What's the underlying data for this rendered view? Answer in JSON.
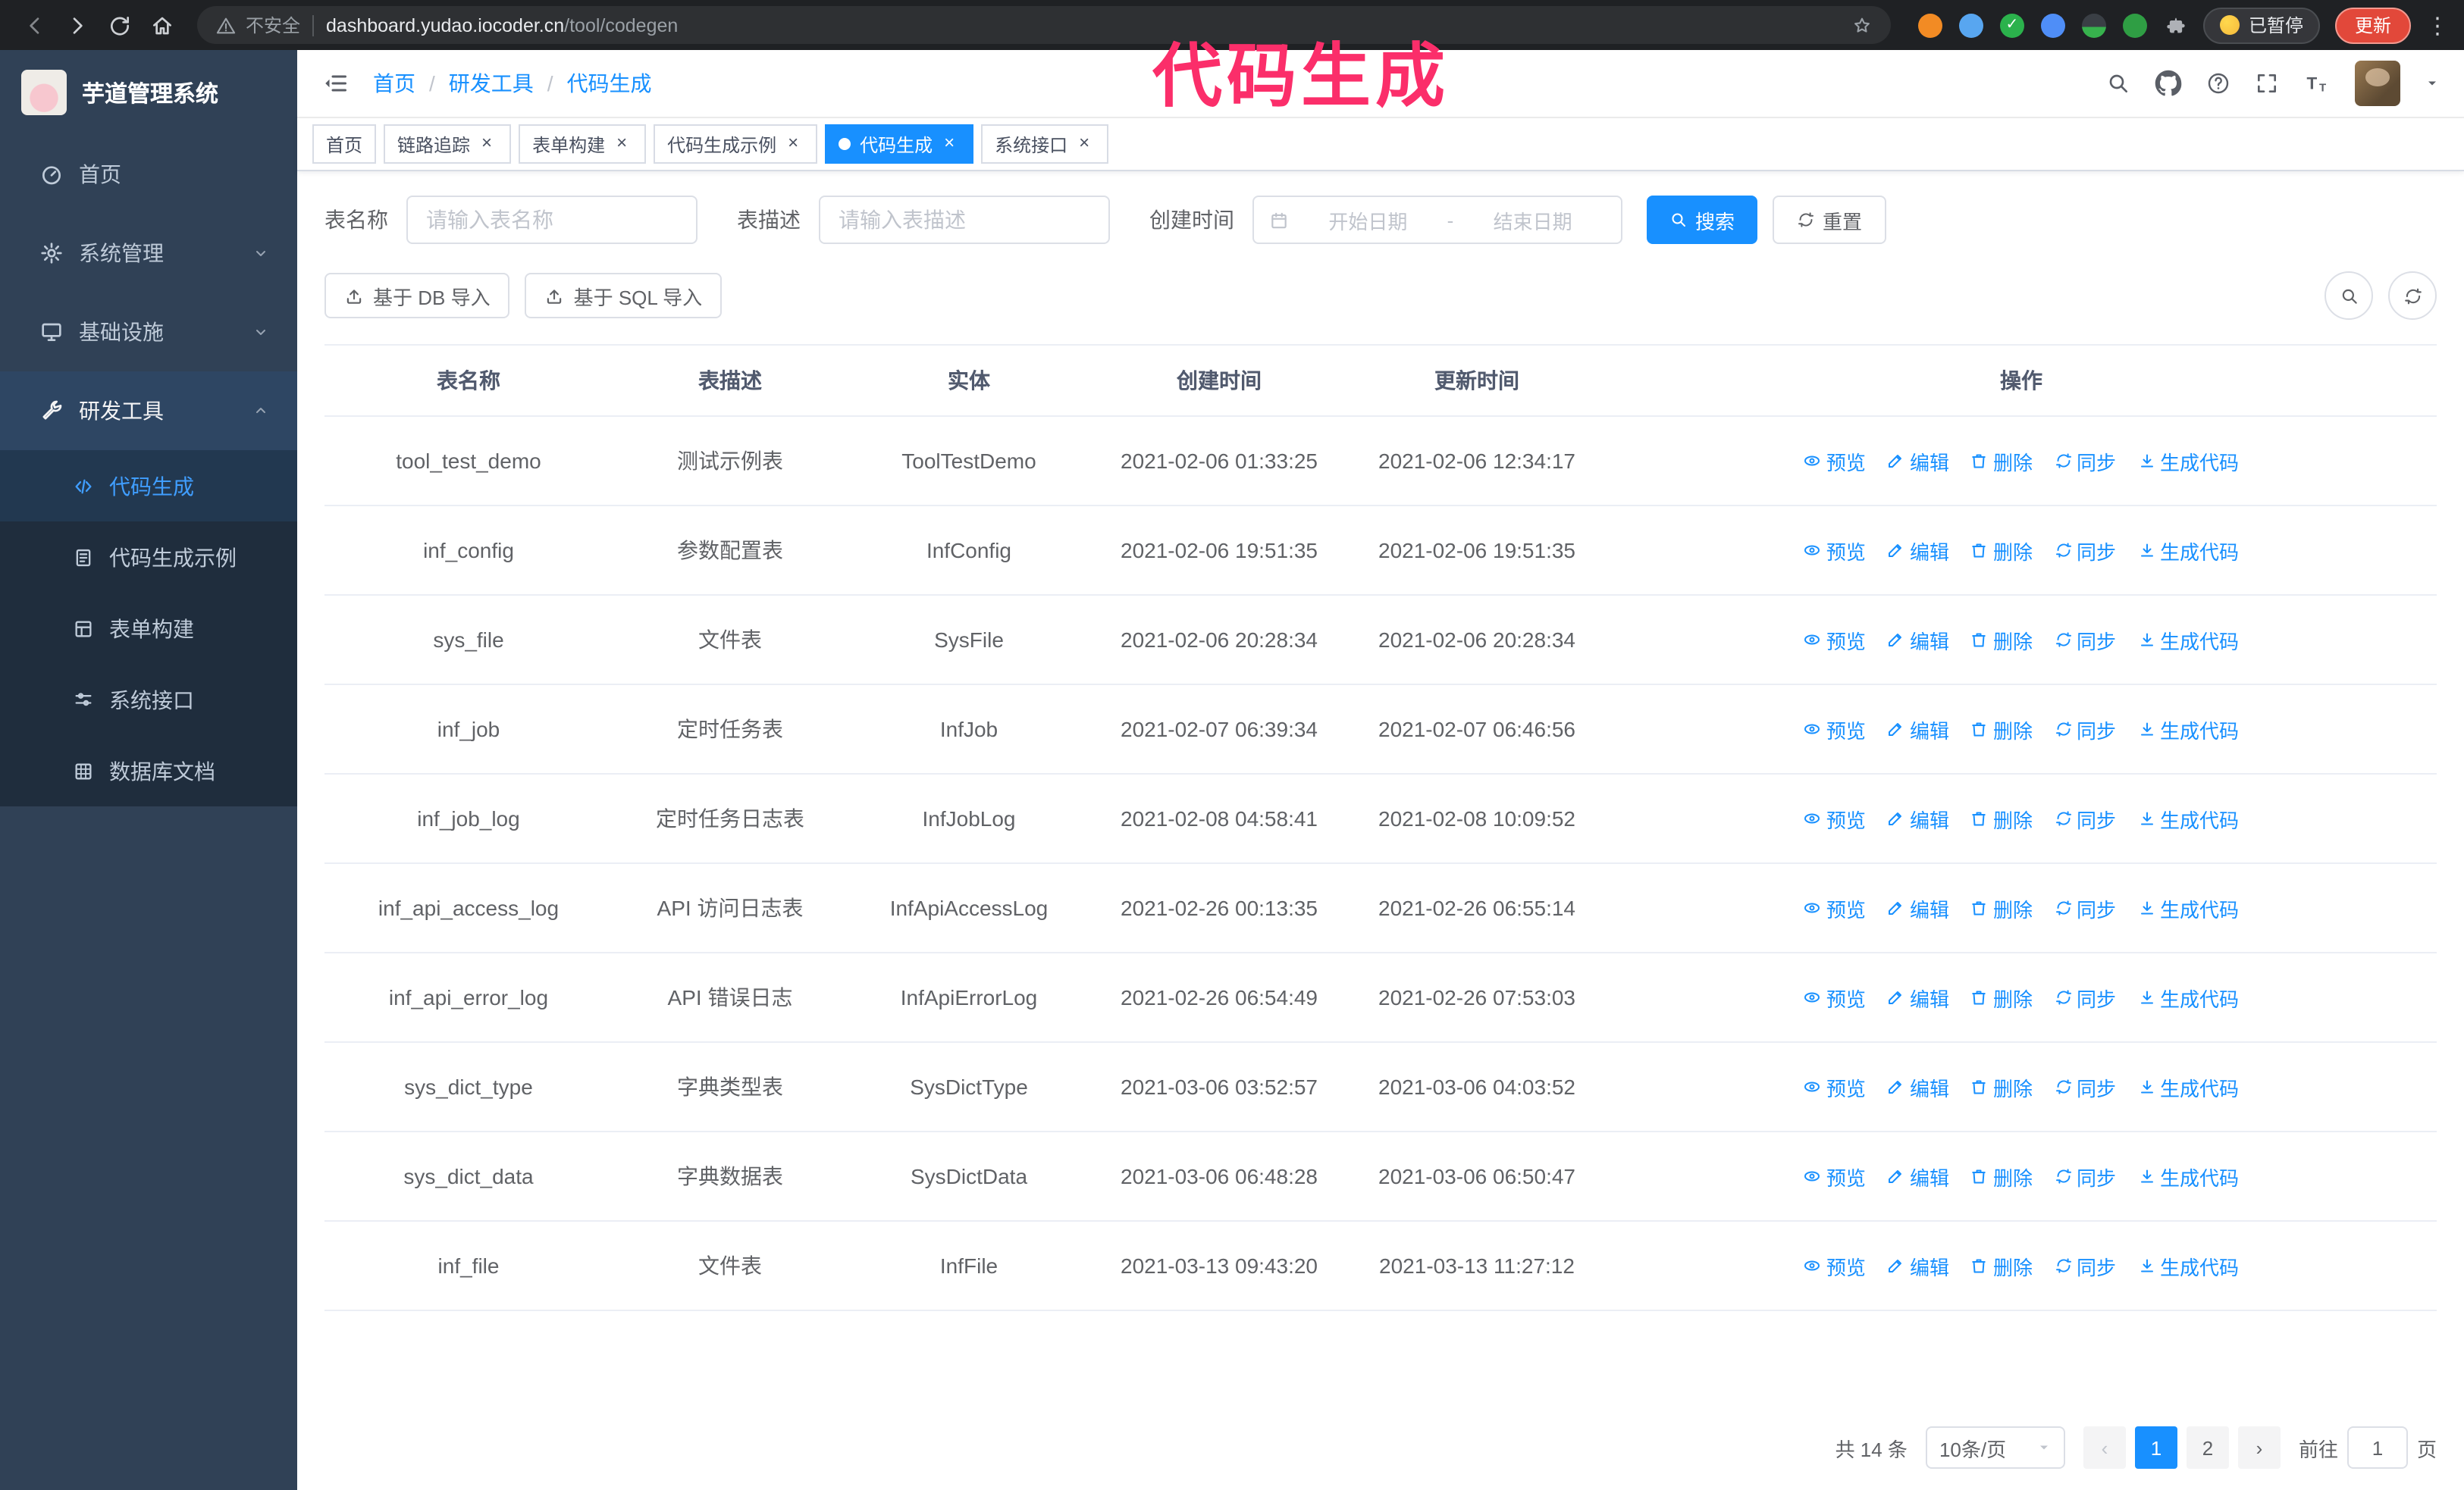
{
  "browser": {
    "security_label": "不安全",
    "url_domain": "dashboard.yudao.iocoder.cn",
    "url_path": "/tool/codegen",
    "paused_badge": "已暂停",
    "update_button": "更新"
  },
  "annotation": "代码生成",
  "glyphs": {
    "close": "×",
    "breadcrumb_separator": "/",
    "date_separator": "-",
    "pager_prev": "‹",
    "pager_next": "›",
    "more_dots": "⋮"
  },
  "sidebar": {
    "logo_title": "芋道管理系统",
    "items": [
      {
        "label": "首页"
      },
      {
        "label": "系统管理"
      },
      {
        "label": "基础设施"
      },
      {
        "label": "研发工具"
      }
    ],
    "subitems": [
      {
        "label": "代码生成"
      },
      {
        "label": "代码生成示例"
      },
      {
        "label": "表单构建"
      },
      {
        "label": "系统接口"
      },
      {
        "label": "数据库文档"
      }
    ]
  },
  "breadcrumb": {
    "items": [
      "首页",
      "研发工具",
      "代码生成"
    ]
  },
  "tabs": [
    {
      "label": "首页"
    },
    {
      "label": "链路追踪"
    },
    {
      "label": "表单构建"
    },
    {
      "label": "代码生成示例"
    },
    {
      "label": "代码生成"
    },
    {
      "label": "系统接口"
    }
  ],
  "filters": {
    "table_name_label": "表名称",
    "table_name_placeholder": "请输入表名称",
    "table_desc_label": "表描述",
    "table_desc_placeholder": "请输入表描述",
    "create_time_label": "创建时间",
    "date_start_placeholder": "开始日期",
    "date_end_placeholder": "结束日期",
    "search_button": "搜索",
    "reset_button": "重置"
  },
  "toolbar": {
    "import_db_label": "基于 DB 导入",
    "import_sql_label": "基于 SQL 导入"
  },
  "table": {
    "columns": [
      "表名称",
      "表描述",
      "实体",
      "创建时间",
      "更新时间",
      "操作"
    ],
    "actions": [
      "预览",
      "编辑",
      "删除",
      "同步",
      "生成代码"
    ],
    "rows": [
      {
        "name": "tool_test_demo",
        "desc": "测试示例表",
        "entity": "ToolTestDemo",
        "created": "2021-02-06 01:33:25",
        "updated": "2021-02-06 12:34:17"
      },
      {
        "name": "inf_config",
        "desc": "参数配置表",
        "entity": "InfConfig",
        "created": "2021-02-06 19:51:35",
        "updated": "2021-02-06 19:51:35"
      },
      {
        "name": "sys_file",
        "desc": "文件表",
        "entity": "SysFile",
        "created": "2021-02-06 20:28:34",
        "updated": "2021-02-06 20:28:34"
      },
      {
        "name": "inf_job",
        "desc": "定时任务表",
        "entity": "InfJob",
        "created": "2021-02-07 06:39:34",
        "updated": "2021-02-07 06:46:56"
      },
      {
        "name": "inf_job_log",
        "desc": "定时任务日志表",
        "entity": "InfJobLog",
        "created": "2021-02-08 04:58:41",
        "updated": "2021-02-08 10:09:52"
      },
      {
        "name": "inf_api_access_log",
        "desc": "API 访问日志表",
        "entity": "InfApiAccessLog",
        "created": "2021-02-26 00:13:35",
        "updated": "2021-02-26 06:55:14"
      },
      {
        "name": "inf_api_error_log",
        "desc": "API 错误日志",
        "entity": "InfApiErrorLog",
        "created": "2021-02-26 06:54:49",
        "updated": "2021-02-26 07:53:03"
      },
      {
        "name": "sys_dict_type",
        "desc": "字典类型表",
        "entity": "SysDictType",
        "created": "2021-03-06 03:52:57",
        "updated": "2021-03-06 04:03:52"
      },
      {
        "name": "sys_dict_data",
        "desc": "字典数据表",
        "entity": "SysDictData",
        "created": "2021-03-06 06:48:28",
        "updated": "2021-03-06 06:50:47"
      },
      {
        "name": "inf_file",
        "desc": "文件表",
        "entity": "InfFile",
        "created": "2021-03-13 09:43:20",
        "updated": "2021-03-13 11:27:12"
      }
    ]
  },
  "pagination": {
    "total_label": "共 14 条",
    "page_size_label": "10条/页",
    "pages": [
      "1",
      "2"
    ],
    "goto_label": "前往",
    "goto_value": "1",
    "goto_unit": "页"
  },
  "colors": {
    "primary": "#1890ff",
    "sidebar_bg": "#304156",
    "submenu_bg": "#1f2d3d",
    "annotation": "#fb2e6a",
    "update_button": "#e2483a"
  }
}
